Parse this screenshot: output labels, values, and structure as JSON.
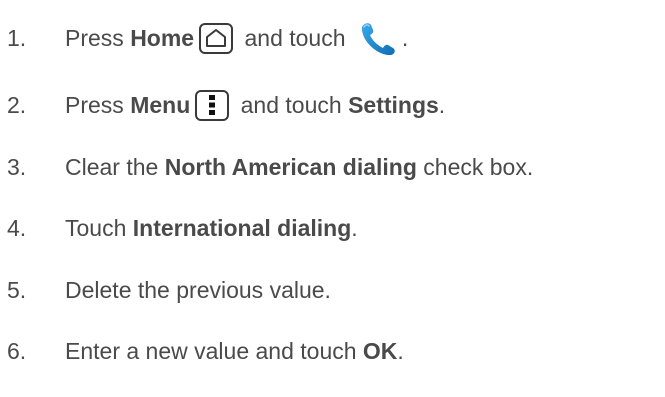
{
  "steps": [
    {
      "num": "1.",
      "pre": "Press ",
      "bold1": "Home",
      "mid": " and touch ",
      "end": "."
    },
    {
      "num": "2.",
      "pre": "Press ",
      "bold1": "Menu",
      "mid": " and touch ",
      "bold2": "Settings",
      "end": "."
    },
    {
      "num": "3.",
      "pre": "Clear the ",
      "bold1": "North American dialing",
      "end": " check box."
    },
    {
      "num": "4.",
      "pre": "Touch ",
      "bold1": "International dialing",
      "end": "."
    },
    {
      "num": "5.",
      "text": "Delete the previous value."
    },
    {
      "num": "6.",
      "pre": "Enter a new value and touch ",
      "bold1": "OK",
      "end": "."
    }
  ],
  "icons": {
    "home_key": "home-key-icon",
    "menu_key": "menu-key-icon",
    "phone": "phone-icon",
    "phone_color": "#1a8fd6",
    "key_border_color": "#3a3a3a"
  },
  "colors": {
    "text": "#4a4a4a",
    "background": "#ffffff"
  }
}
